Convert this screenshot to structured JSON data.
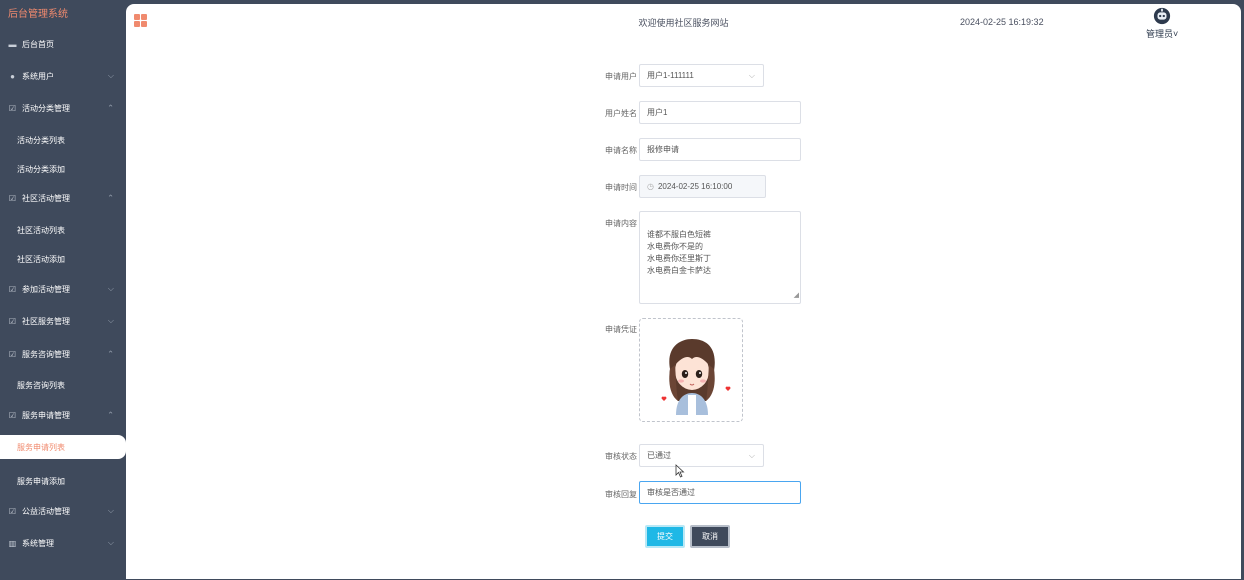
{
  "sidebar": {
    "brand": "后台管理系统",
    "items": [
      {
        "label": "后台首页",
        "icon": "monitor-icon",
        "chevron": ""
      },
      {
        "label": "系统用户",
        "icon": "user-icon",
        "chevron": "⌵"
      },
      {
        "label": "活动分类管理",
        "icon": "checkbox-icon",
        "chevron": "⌃"
      },
      {
        "label": "活动分类列表",
        "icon": "",
        "chevron": ""
      },
      {
        "label": "活动分类添加",
        "icon": "",
        "chevron": ""
      },
      {
        "label": "社区活动管理",
        "icon": "checkbox-icon",
        "chevron": "⌃"
      },
      {
        "label": "社区活动列表",
        "icon": "",
        "chevron": ""
      },
      {
        "label": "社区活动添加",
        "icon": "",
        "chevron": ""
      },
      {
        "label": "参加活动管理",
        "icon": "checkbox-icon",
        "chevron": "⌵"
      },
      {
        "label": "社区服务管理",
        "icon": "checkbox-icon",
        "chevron": "⌵"
      },
      {
        "label": "服务咨询管理",
        "icon": "checkbox-icon",
        "chevron": "⌃"
      },
      {
        "label": "服务咨询列表",
        "icon": "",
        "chevron": ""
      },
      {
        "label": "服务申请管理",
        "icon": "checkbox-icon",
        "chevron": "⌃"
      },
      {
        "label": "服务申请列表",
        "icon": "",
        "chevron": ""
      },
      {
        "label": "服务申请添加",
        "icon": "",
        "chevron": ""
      },
      {
        "label": "公益活动管理",
        "icon": "checkbox-icon",
        "chevron": "⌵"
      },
      {
        "label": "系统管理",
        "icon": "bar-chart-icon",
        "chevron": "⌵"
      }
    ],
    "active_item": "服务申请列表"
  },
  "header": {
    "welcome": "欢迎使用社区服务网站",
    "datetime": "2024-02-25 16:19:32",
    "user_label": "管理员",
    "user_chevron": "˅"
  },
  "form": {
    "applicant_user": {
      "label": "申请用户",
      "value": "用户1-111111"
    },
    "user_name": {
      "label": "用户姓名",
      "value": "用户1"
    },
    "apply_name": {
      "label": "申请名称",
      "value": "报修申请"
    },
    "apply_time": {
      "label": "申请时间",
      "value": "2024-02-25 16:10:00"
    },
    "apply_content": {
      "label": "申请内容",
      "value": "谁都不服白色短裤\n水电费你不是的\n水电费你还里斯丁\n水电费白金卡萨达"
    },
    "apply_proof": {
      "label": "申请凭证"
    },
    "review_status": {
      "label": "审核状态",
      "value": "已通过"
    },
    "review_reply": {
      "label": "审核回复",
      "value": "审核是否通过"
    },
    "submit_label": "提交",
    "cancel_label": "取消"
  },
  "colors": {
    "sidebar_bg": "#3f4a5c",
    "accent": "#f08a6e",
    "submit": "#1fb8e6"
  }
}
